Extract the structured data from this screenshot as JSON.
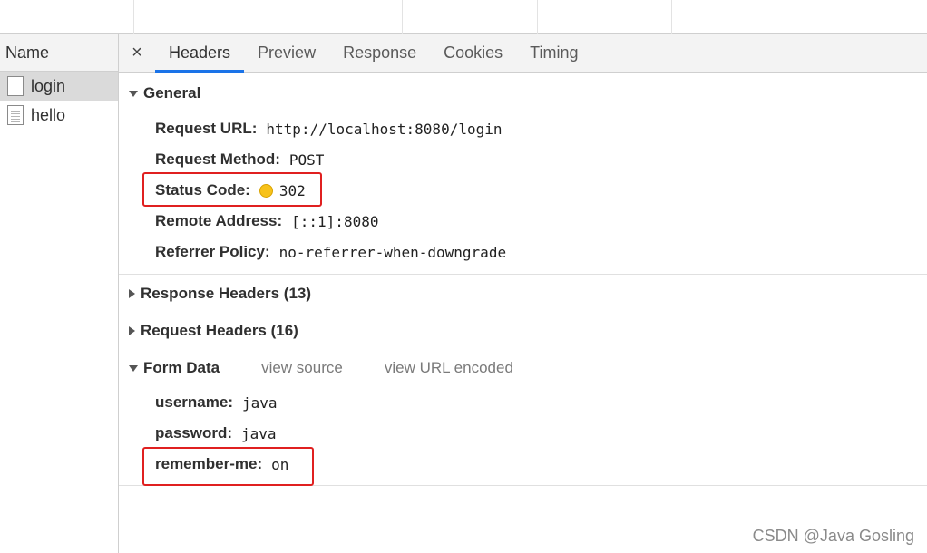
{
  "name_panel": {
    "header": "Name",
    "requests": [
      {
        "name": "login",
        "selected": true
      },
      {
        "name": "hello",
        "selected": false
      }
    ]
  },
  "tabs": {
    "close": "×",
    "items": [
      "Headers",
      "Preview",
      "Response",
      "Cookies",
      "Timing"
    ],
    "active": "Headers"
  },
  "general": {
    "title": "General",
    "rows": [
      {
        "key": "Request URL:",
        "value": "http://localhost:8080/login"
      },
      {
        "key": "Request Method:",
        "value": "POST"
      },
      {
        "key": "Status Code:",
        "value": "302",
        "status_color": "#f7c21a"
      },
      {
        "key": "Remote Address:",
        "value": "[::1]:8080"
      },
      {
        "key": "Referrer Policy:",
        "value": "no-referrer-when-downgrade"
      }
    ]
  },
  "response_headers": {
    "title": "Response Headers (13)"
  },
  "request_headers": {
    "title": "Request Headers (16)"
  },
  "form_data": {
    "title": "Form Data",
    "view_source": "view source",
    "view_url_encoded": "view URL encoded",
    "rows": [
      {
        "key": "username:",
        "value": "java"
      },
      {
        "key": "password:",
        "value": "java"
      },
      {
        "key": "remember-me:",
        "value": "on"
      }
    ]
  },
  "highlight_color": "#e02020",
  "accent_color": "#1a73e8",
  "watermark": "CSDN @Java Gosling"
}
